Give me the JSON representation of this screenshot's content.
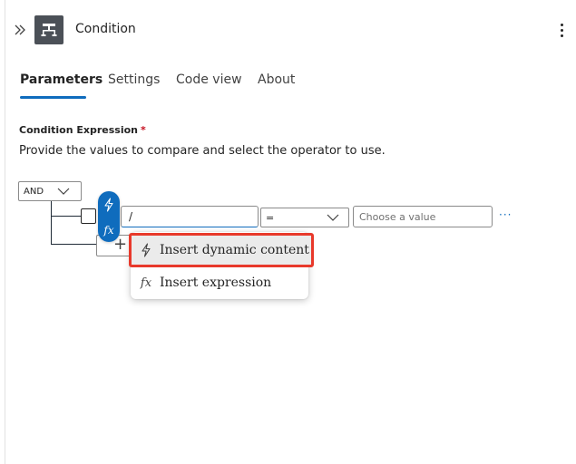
{
  "header": {
    "title": "Condition",
    "icon": "condition-icon",
    "icon_bg": "#4b5057"
  },
  "tabs": [
    {
      "label": "Parameters",
      "active": true
    },
    {
      "label": "Settings",
      "active": false
    },
    {
      "label": "Code view",
      "active": false
    },
    {
      "label": "About",
      "active": false
    }
  ],
  "accent": "#0f6cbd",
  "condition": {
    "label": "Condition Expression",
    "required_marker": "*",
    "help": "Provide the values to compare and select the operator to use.",
    "group_operator": "AND",
    "row": {
      "left_value": "/",
      "operator": "=",
      "right_placeholder": "Choose a value",
      "more": "···"
    },
    "add": "+"
  },
  "pill": {
    "dynamic_icon": "lightning-icon",
    "expression_label": "fx"
  },
  "menu": {
    "items": [
      {
        "label": "Insert dynamic content",
        "icon": "lightning-icon",
        "highlighted": true,
        "highlight_color": "#e8392b"
      },
      {
        "label": "Insert expression",
        "icon": "fx"
      }
    ]
  }
}
